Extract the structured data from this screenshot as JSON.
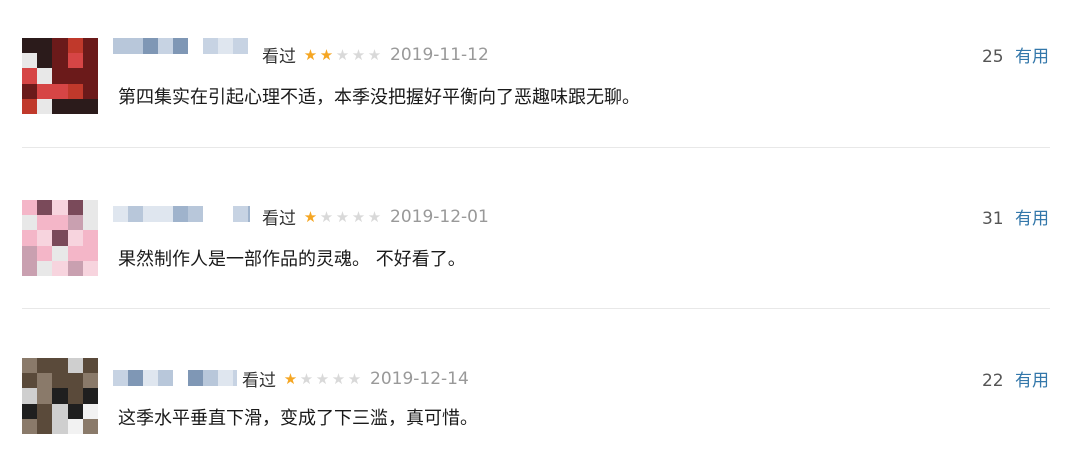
{
  "comments": [
    {
      "status": "看过",
      "rating": 2,
      "max_rating": 5,
      "date": "2019-11-12",
      "text": "第四集实在引起心理不适，本季没把握好平衡向了恶趣味跟无聊。",
      "votes": "25",
      "useful_label": "有用",
      "avatar_palette": [
        "#c0392b",
        "#e8e8e8",
        "#2b1b1b",
        "#d64545",
        "#6b1a1a"
      ]
    },
    {
      "status": "看过",
      "rating": 1,
      "max_rating": 5,
      "date": "2019-12-01",
      "text": "果然制作人是一部作品的灵魂。 不好看了。",
      "votes": "31",
      "useful_label": "有用",
      "avatar_palette": [
        "#f4b6c8",
        "#e8e8e8",
        "#c9a0b0",
        "#f7d4de",
        "#7a4a5a"
      ]
    },
    {
      "status": "看过",
      "rating": 1,
      "max_rating": 5,
      "date": "2019-12-14",
      "text": "这季水平垂直下滑，变成了下三滥，真可惜。",
      "votes": "22",
      "useful_label": "有用",
      "avatar_palette": [
        "#1f1f1f",
        "#f2f2f2",
        "#5a4a3a",
        "#cfcfcf",
        "#8a7a6a"
      ]
    }
  ],
  "colors": {
    "star_on": "#f5a623",
    "star_off": "#d9d9d9",
    "useful_link": "#3377aa",
    "date": "#999999"
  }
}
